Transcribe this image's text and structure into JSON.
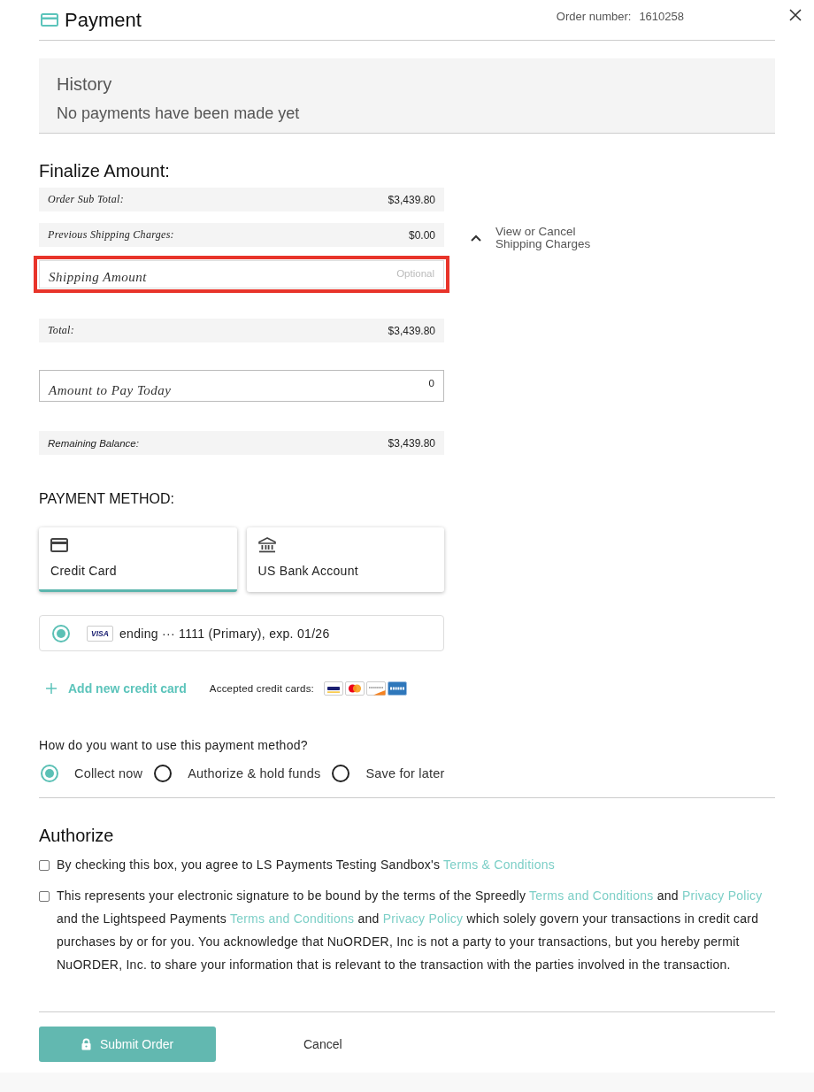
{
  "header": {
    "title": "Payment",
    "order_label": "Order number:",
    "order_number": "1610258"
  },
  "history": {
    "title": "History",
    "message": "No payments have been made yet"
  },
  "finalize": {
    "title": "Finalize Amount:",
    "rows": [
      {
        "kind": "summary",
        "label": "Order Sub Total:",
        "value": "$3,439.80"
      },
      {
        "kind": "summary",
        "label": "Previous Shipping Charges:",
        "value": "$0.00"
      },
      {
        "kind": "input",
        "label": "Shipping Amount",
        "placeholder": "Optional",
        "highlighted": true
      },
      {
        "kind": "summary",
        "label": "Total:",
        "value": "$3,439.80"
      },
      {
        "kind": "input",
        "label": "Amount to Pay Today",
        "value": "0",
        "highlighted": false
      },
      {
        "kind": "balance",
        "label": "Remaining Balance:",
        "value": "$3,439.80"
      }
    ],
    "shipping_toggle": {
      "label": "View or Cancel Shipping Charges",
      "expanded": true
    }
  },
  "payment_method": {
    "title": "PAYMENT METHOD:",
    "tabs": [
      {
        "kind": "card",
        "label": "Credit Card",
        "selected": true
      },
      {
        "kind": "bank",
        "label": "US Bank Account",
        "selected": false
      }
    ],
    "saved_cards": [
      {
        "brand": "VISA",
        "label": "ending ··· 1111 (Primary), exp. 01/26",
        "selected": true
      }
    ],
    "add_card": "Add new credit card",
    "accepted_label": "Accepted credit cards:"
  },
  "usage": {
    "question": "How do you want to use this payment method?",
    "options": [
      {
        "label": "Collect now",
        "selected": true
      },
      {
        "label": "Authorize & hold funds",
        "selected": false
      },
      {
        "label": "Save for later",
        "selected": false
      }
    ]
  },
  "authorize": {
    "title": "Authorize",
    "consents": [
      {
        "checked": false,
        "parts": [
          {
            "kind": "text",
            "text": "By checking this box, you agree to LS Payments Testing Sandbox's "
          },
          {
            "kind": "link",
            "text": "Terms & Conditions"
          }
        ]
      },
      {
        "checked": false,
        "parts": [
          {
            "kind": "text",
            "text": "This represents your electronic signature to be bound by the terms of the Spreedly "
          },
          {
            "kind": "link",
            "text": "Terms and Conditions"
          },
          {
            "kind": "text",
            "text": " and "
          },
          {
            "kind": "link",
            "text": "Privacy Policy"
          },
          {
            "kind": "text",
            "text": " and the Lightspeed Payments "
          },
          {
            "kind": "link",
            "text": "Terms and Conditions"
          },
          {
            "kind": "text",
            "text": " and "
          },
          {
            "kind": "link",
            "text": "Privacy Policy"
          },
          {
            "kind": "text",
            "text": " which solely govern your transactions in credit card purchases by or for you. You acknowledge that NuORDER, Inc is not a party to your transactions, but you hereby permit NuORDER, Inc. to share your information that is relevant to the transaction with the parties involved in the transaction."
          }
        ]
      }
    ]
  },
  "actions": {
    "submit": "Submit Order",
    "cancel": "Cancel"
  }
}
